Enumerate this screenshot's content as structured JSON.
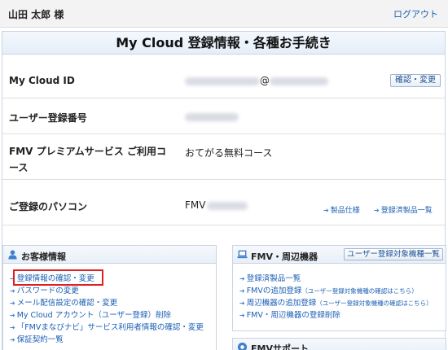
{
  "header": {
    "user_name": "山田 太郎 様",
    "logout_label": "ログアウト"
  },
  "page_title": "My Cloud 登録情報・各種お手続き",
  "rows": [
    {
      "label": "My Cloud ID",
      "value_tail": "@",
      "button": "確認・変更"
    },
    {
      "label": "ユーザー登録番号"
    },
    {
      "label_line1": "FMV プレミアムサービス ご利用コ",
      "label_line2": "ース",
      "value": "おてがる無料コース"
    },
    {
      "label": "ご登録のパソコン",
      "value_prefix": "FMV",
      "links": [
        "製品仕様",
        "登録済製品一覧"
      ]
    }
  ],
  "customer": {
    "title": "お客様情報",
    "items": [
      "登録情報の確認・変更",
      "パスワードの変更",
      "メール配信設定の確認・変更",
      "My Cloud アカウント（ユーザー登録）削除",
      "「FMVまなびナビ」サービス利用者情報の確認・変更",
      "保証契約一覧"
    ]
  },
  "fmv": {
    "title": "FMV・周辺機器",
    "button": "ユーザー登録対象機種一覧",
    "items": [
      {
        "text": "登録済製品一覧",
        "note": ""
      },
      {
        "text": "FMVの追加登録",
        "note": "（ユーザー登録対象機種の確認はこちら）"
      },
      {
        "text": "周辺機器の追加登録",
        "note": "（ユーザー登録対象機種の確認はこちら）"
      },
      {
        "text": "FMV・周辺機器の登録削除",
        "note": ""
      }
    ]
  },
  "support": {
    "title": "FMVサポート"
  },
  "colors": {
    "link": "#1a5fb4",
    "highlight": "#e02020",
    "accent": "#3f7fcf"
  }
}
